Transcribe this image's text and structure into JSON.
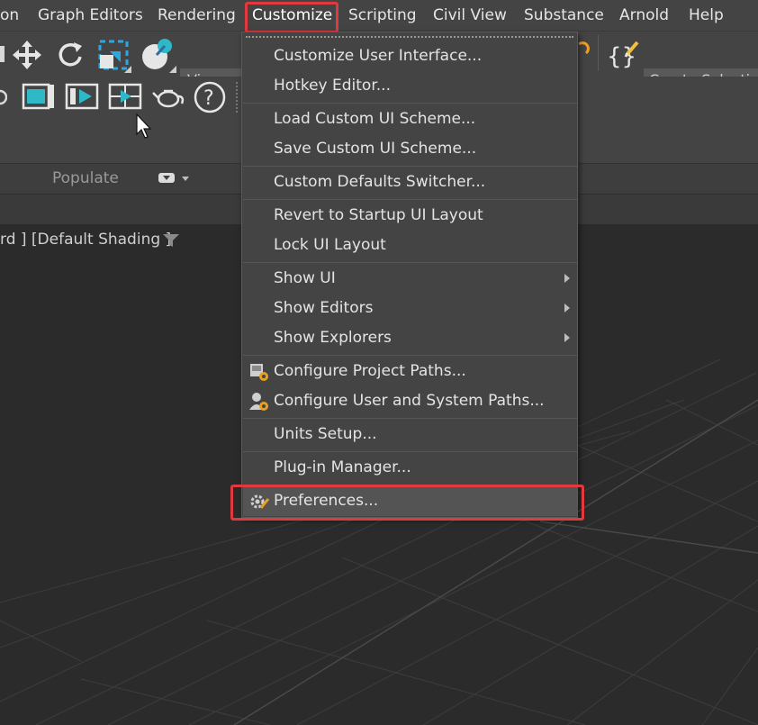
{
  "menubar": {
    "items": [
      {
        "label": "on"
      },
      {
        "label": "Graph Editors"
      },
      {
        "label": "Rendering"
      },
      {
        "label": "Customize"
      },
      {
        "label": "Scripting"
      },
      {
        "label": "Civil View"
      },
      {
        "label": "Substance"
      },
      {
        "label": "Arnold"
      },
      {
        "label": "Help"
      }
    ]
  },
  "toolbar": {
    "view_dropdown": "View",
    "selection_set_placeholder": "Create Selection S",
    "icons": [
      "move-icon",
      "rotate-icon",
      "scale-icon",
      "snap-icon",
      "render-frame-icon",
      "render-setup-icon",
      "render-icon",
      "teapot-render-icon",
      "help-icon",
      "braces-edit-icon"
    ]
  },
  "ribbon": {
    "populate_label": "Populate"
  },
  "viewport": {
    "header": "rd ] [Default Shading ]"
  },
  "customize_menu": {
    "items": [
      {
        "label": "Customize User Interface...",
        "submenu": false
      },
      {
        "label": "Hotkey Editor...",
        "submenu": false
      },
      {
        "label": "Load Custom UI Scheme...",
        "submenu": false
      },
      {
        "label": "Save Custom UI Scheme...",
        "submenu": false
      },
      {
        "label": "Custom Defaults Switcher...",
        "submenu": false
      },
      {
        "label": "Revert to Startup UI Layout",
        "submenu": false
      },
      {
        "label": "Lock UI Layout",
        "submenu": false
      },
      {
        "label": "Show UI",
        "submenu": true
      },
      {
        "label": "Show Editors",
        "submenu": true
      },
      {
        "label": "Show Explorers",
        "submenu": true
      },
      {
        "label": "Configure Project Paths...",
        "submenu": false,
        "icon": "project-paths-icon"
      },
      {
        "label": "Configure User and System Paths...",
        "submenu": false,
        "icon": "user-paths-icon"
      },
      {
        "label": "Units Setup...",
        "submenu": false
      },
      {
        "label": "Plug-in Manager...",
        "submenu": false
      },
      {
        "label": "Preferences...",
        "submenu": false,
        "icon": "preferences-gear-icon"
      }
    ]
  },
  "colors": {
    "highlight": "#e0393e",
    "menu_bg": "#444444",
    "viewport_bg": "#2b2b2b"
  }
}
